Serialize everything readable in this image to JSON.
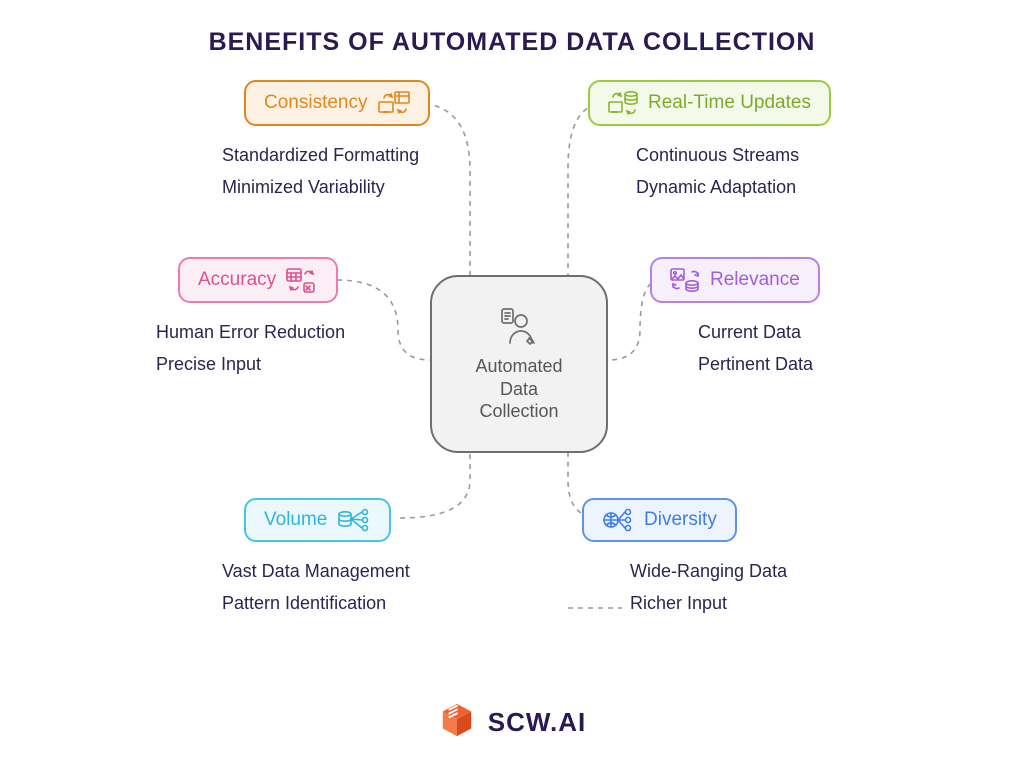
{
  "title": "BENEFITS OF AUTOMATED DATA COLLECTION",
  "center": {
    "label": "Automated\nData\nCollection",
    "icon": "user-data-icon"
  },
  "benefits": {
    "consistency": {
      "label": "Consistency",
      "icon": "sync-table-icon",
      "color": "#e0881e",
      "bullets": [
        "Standardized Formatting",
        "Minimized Variability"
      ]
    },
    "realtime": {
      "label": "Real-Time Updates",
      "icon": "sync-db-icon",
      "color": "#7fa92d",
      "bullets": [
        "Continuous Streams",
        "Dynamic Adaptation"
      ]
    },
    "accuracy": {
      "label": "Accuracy",
      "icon": "calc-xfer-icon",
      "color": "#e04f8f",
      "bullets": [
        "Human Error Reduction",
        "Precise Input"
      ]
    },
    "relevance": {
      "label": "Relevance",
      "icon": "image-db-icon",
      "color": "#a35ed6",
      "bullets": [
        "Current Data",
        "Pertinent Data"
      ]
    },
    "volume": {
      "label": "Volume",
      "icon": "db-nodes-icon",
      "color": "#2eb6d6",
      "bullets": [
        "Vast Data Management",
        "Pattern Identification"
      ]
    },
    "diversity": {
      "label": "Diversity",
      "icon": "globe-nodes-icon",
      "color": "#3d7fe4",
      "bullets": [
        "Wide-Ranging Data",
        "Richer Input"
      ]
    }
  },
  "footer": {
    "brand": "SCW.AI",
    "icon": "scw-cube-icon",
    "icon_color": "#f05a28"
  }
}
